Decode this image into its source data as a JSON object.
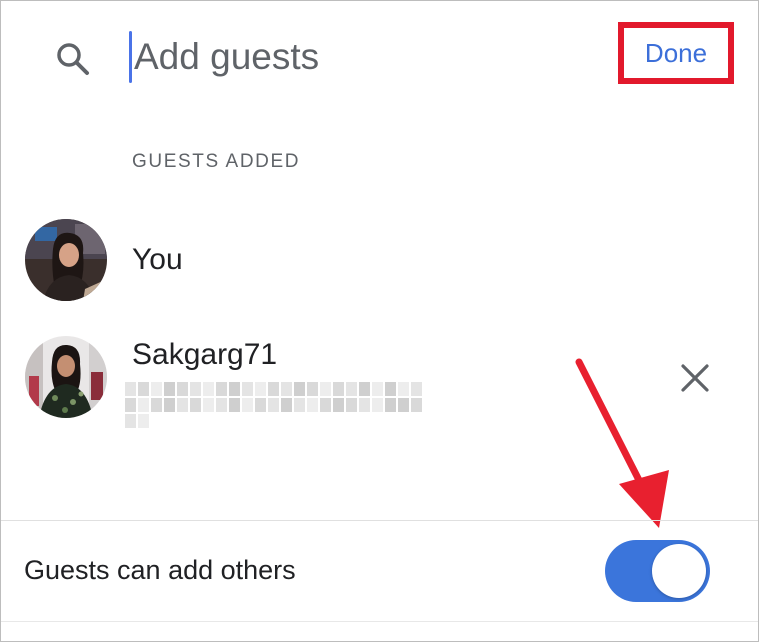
{
  "header": {
    "search_placeholder": "Add guests",
    "done_label": "Done"
  },
  "guests_section": {
    "title": "GUESTS ADDED",
    "guests": [
      {
        "name": "You",
        "removable": false
      },
      {
        "name": "Sakgarg71",
        "email_obscured": true,
        "removable": true
      }
    ]
  },
  "options": {
    "guests_can_add_others_label": "Guests can add others",
    "guests_can_add_others_enabled": true
  },
  "icons": {
    "search": "search-icon",
    "remove": "close-icon",
    "annotation": "red-arrow"
  },
  "colors": {
    "accent": "#3c6fd9",
    "toggle_on": "#3b75db",
    "highlight": "#e2192c",
    "cursor": "#4a73e8"
  }
}
